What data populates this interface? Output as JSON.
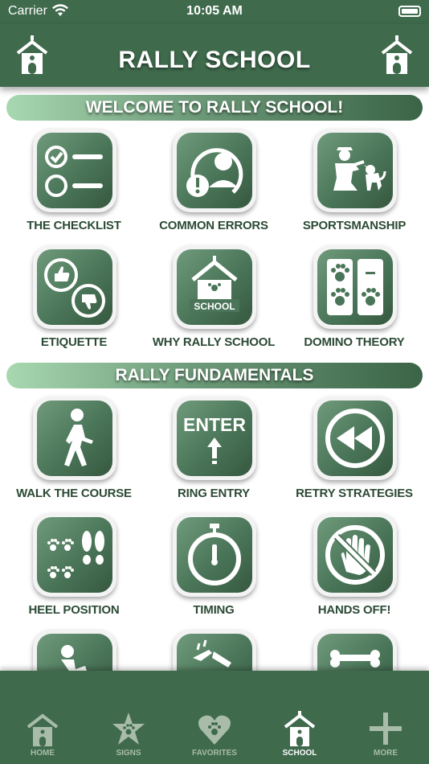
{
  "status_bar": {
    "carrier": "Carrier",
    "time": "10:05 AM"
  },
  "header": {
    "title": "RALLY SCHOOL",
    "left_icon": "schoolhouse-icon",
    "right_icon": "schoolhouse-icon"
  },
  "sections": [
    {
      "title": "WELCOME TO RALLY SCHOOL!"
    },
    {
      "title": "RALLY FUNDAMENTALS"
    }
  ],
  "tiles": [
    {
      "label": "THE CHECKLIST",
      "icon": "checklist-icon"
    },
    {
      "label": "COMMON ERRORS",
      "icon": "person-error-icon"
    },
    {
      "label": "SPORTSMANSHIP",
      "icon": "handler-dog-icon"
    },
    {
      "label": "ETIQUETTE",
      "icon": "thumbs-up-down-icon"
    },
    {
      "label": "WHY RALLY SCHOOL",
      "icon": "school-house-icon",
      "icon_text": "SCHOOL"
    },
    {
      "label": "DOMINO THEORY",
      "icon": "paw-domino-icon"
    },
    {
      "label": "WALK THE COURSE",
      "icon": "walking-person-icon"
    },
    {
      "label": "RING ENTRY",
      "icon": "enter-arrow-icon",
      "icon_text": "ENTER"
    },
    {
      "label": "RETRY STRATEGIES",
      "icon": "rewind-icon"
    },
    {
      "label": "HEEL POSITION",
      "icon": "paws-footprints-icon"
    },
    {
      "label": "TIMING",
      "icon": "stopwatch-icon"
    },
    {
      "label": "HANDS OFF!",
      "icon": "no-hand-icon"
    }
  ],
  "tab_bar": {
    "active": "SCHOOL",
    "tabs": [
      {
        "label": "HOME",
        "icon": "home-icon"
      },
      {
        "label": "SIGNS",
        "icon": "star-paw-icon"
      },
      {
        "label": "FAVORITES",
        "icon": "heart-paw-icon"
      },
      {
        "label": "SCHOOL",
        "icon": "school-icon"
      },
      {
        "label": "MORE",
        "icon": "plus-icon"
      }
    ]
  },
  "colors": {
    "primary": "#3f6a4c",
    "tile_dark": "#36583f",
    "tile_light": "#6f9a7b",
    "label": "#2c4a35",
    "banner_light": "#a8d8b0"
  }
}
